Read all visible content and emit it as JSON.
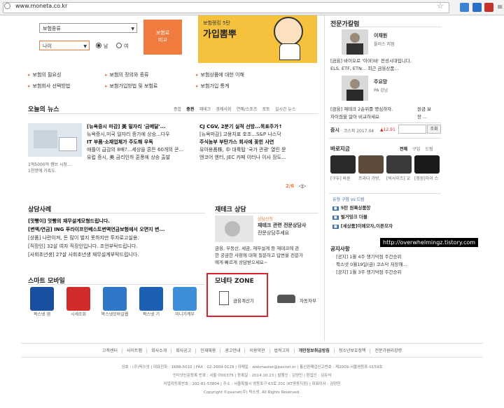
{
  "browser": {
    "url": "www.moneta.co.kr"
  },
  "insurance": {
    "type_select": "보험종류",
    "age_select": "나이",
    "gender_m": "남",
    "gender_f": "여",
    "compare_btn_line1": "보험료",
    "compare_btn_line2": "비교",
    "banner_small": "보험랭킹 5탄",
    "banner_big": "가입뽐뿌",
    "links": [
      "보험의 필요성",
      "보험의 정의와 종류",
      "보험상품에 대한 이해",
      "보험회사 선택방법",
      "보험가입방법 및 보험료",
      "보험가입 통계"
    ]
  },
  "news": {
    "title": "오늘의 뉴스",
    "tabs": [
      "종합",
      "증권",
      "재테크",
      "경제사회",
      "연예/스포츠",
      "포토",
      "실시간 뉴스"
    ],
    "photo_caption_1": "1억5000억 캠브 시장...",
    "photo_caption_2": "1천명에 가혹도.",
    "col1": [
      "[뉴욕증시 마감] 美 밀자리 '금메달'...",
      "뉴욕증시,미국 일자리 증가에 상승...다우",
      "IT 부품·소재업체가 주도해 우독",
      "애플이 급감의 8배?...세상을 혼든 60개의 콘...",
      "유럽 증시, 美 금리인하 훈풍에 상승 출발"
    ],
    "col2": [
      "CJ CGV, 2분기 실적 선방...목표주가↑",
      "[뉴욕마감] 고용지표 호조...S&P 나스닥",
      "주식농부 부탄가스 회사에 꽂힌 사연",
      "유아용품株, 中 대륙탑 '국가 관광' 열린 문",
      "엔코어 엔터, JEC 카페 이터나 이사 장도..."
    ],
    "page": "2/6"
  },
  "consult": {
    "title": "상담사례",
    "lines": [
      "[맛빵이] 맛빵의 재무설계모형드립니다.",
      "[변액/연금] ING 푸라이프인베스트변액연금보험에서 오면지 변...",
      "[상품] 나란이져, 돈 많이 벌지 못하지만 투자로고실용.",
      "[직장인] 32살 여자 직장인입니다. 조언부탁드립니다.",
      "[사회초년생] 27살 사회초년생 재무설계부탁드립니다."
    ]
  },
  "jaetech": {
    "title": "재테크 상담",
    "tag": "상담신청",
    "headline_1": "재테크 관련 전문상담사",
    "headline_2": "전문상담주세요",
    "body": [
      "금융, 부동산, 세금, 재무설계 등 재테크에 관",
      "한 궁금한 사항에 대해 질문하고 답변을 전문가",
      "에게 빠르게 상담받으세요~"
    ]
  },
  "mobile": {
    "title": "스마트 모바일",
    "apps": [
      {
        "name": "팍스넷 앱",
        "color": "#1a4ea0",
        "icon": "paxnet-app-icon"
      },
      {
        "name": "시세조회",
        "color": "#d22b2b",
        "icon": "quote-app-icon"
      },
      {
        "name": "팍스넷모바일웹",
        "color": "#2f77c9",
        "icon": "pax-mobile-web-icon"
      },
      {
        "name": "팍스넷 기",
        "color": "#1d5fb3",
        "icon": "pax-app-icon"
      },
      {
        "name": "미니가계부",
        "color": "#3c8ed8",
        "icon": "mini-ledger-icon"
      }
    ]
  },
  "moneta_zone": {
    "title": "모네타 ZONE",
    "calc": "금융계산기",
    "car": "자동차부"
  },
  "sidebar": {
    "expert_title": "전문가칼럼",
    "expert1_name": "이채원",
    "expert1_sub": "플러스 지점",
    "expert1_text_1": "[금융] 바이오로 '이(E)바' 전성시대입니다.",
    "expert1_text_2": "ELS, ETF, ETN… 최근 금융상품...",
    "expert2_name": "주요망",
    "expert2_sub": "PA 강남",
    "expert2_text_1": "[금융] 재테크 2순위를 명심하자.",
    "expert2_text_2": "차이점을 알아 비교하세요",
    "expert2_text_3": "원금 보",
    "expert2_text_4": "장 ...",
    "stock_label": "증시",
    "stock_text": "· 코스피 2017.04",
    "stock_change": "▲12.91",
    "stock_btn": "조회",
    "shopping_title": "바로지금",
    "shopping_tabs": [
      "전체",
      "구입",
      "드럼"
    ],
    "products": [
      {
        "name": "[구두] 바른",
        "color": "#2a2a2a"
      },
      {
        "name": "프라다 가방.",
        "color": "#5c4a3a"
      },
      {
        "name": "[빅사이즈] 교",
        "color": "#3a3a3a"
      },
      {
        "name": "[정장]하이 스",
        "color": "#1a1a1a"
      }
    ],
    "hot_tabs": "유형 구함 vs 드럼",
    "hot": [
      "5탄 원룩상품장",
      "벌거밍크 더블",
      "[세상품]이메모자,이른모자"
    ],
    "notice_title": "공지사항",
    "notices": [
      "[공지] 1월 4주 챙기덕점 주간승위",
      "팍스넷 0월19일(금) 코스닥 저장해...",
      "[공지] 1월 3주 챙기덕점 주간승위"
    ]
  },
  "watermark": "http://overwhelmingz.tistory.com",
  "footer": {
    "nav": [
      "고객센터",
      "사이트맵",
      "회사소개",
      "회사공고",
      "인재채용",
      "광고안내",
      "이용약관",
      "법적고지",
      "개인정보취급방침",
      "청소년보호정책",
      "전문가원리강령"
    ],
    "line1": "상호 : (주)팍스넷 | 대표전화 : 1688-5010 | FAX : 02-2669-0129 | 이메일 : webmaster@paxnet.kr | 통신판매업신고번호 : 제2009-서울영등포-0159호",
    "line2": "인터넷신문등록 번호 : 서울 아00375 | 등록일 : 2014.10.23 | 발행인 : 김양민 | 편집인 : 김유석",
    "line3": "사업자등록번호 : 202-81-53804 | 주소 : 서울특별시 영등포구 63로 201 (KT영동지점) | 대표이사 : 김양민",
    "line4": "Copyright ©paxnet(주) 팍스넷. All Rights Reserved."
  }
}
